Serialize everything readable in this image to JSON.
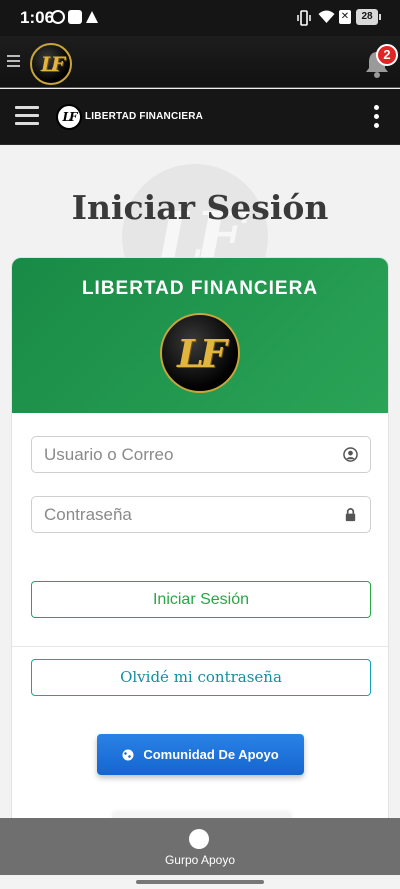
{
  "status_bar": {
    "time": "1:06",
    "battery": "28"
  },
  "app_bar": {
    "logo_text": "LF",
    "notification_count": "2"
  },
  "navbar": {
    "logo_text": "LF",
    "brand": "LIBERTAD FINANCIERA"
  },
  "page": {
    "title": "Iniciar Sesión",
    "watermark": "LF"
  },
  "card": {
    "brand": "LIBERTAD FINANCIERA",
    "logo_text": "LF",
    "username_placeholder": "Usuario o Correo",
    "password_placeholder": "Contraseña",
    "login_label": "Iniciar Sesión",
    "forgot_label": "Olvidé mi contraseña",
    "community_label": "Comunidad De Apoyo"
  },
  "bottom_bar": {
    "label": "Gurpo Apoyo"
  },
  "colors": {
    "header_green": "#198a46",
    "login_green": "#28a745",
    "forgot_teal": "#17a2b8",
    "community_blue": "#1565d0",
    "badge_red": "#e32424",
    "logo_gold": "#e2b63e"
  }
}
